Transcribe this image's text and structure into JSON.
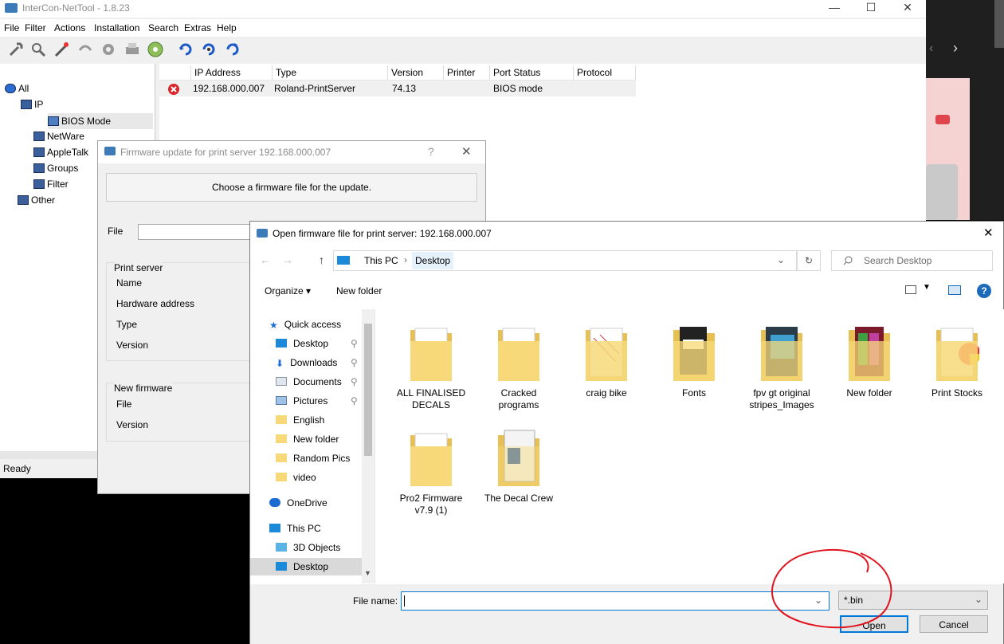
{
  "app": {
    "title": "InterCon-NetTool - 1.8.23",
    "menu": [
      "File",
      "Filter",
      "Actions",
      "Installation",
      "Search",
      "Extras",
      "Help"
    ],
    "tree": {
      "all": "All",
      "ip": "IP",
      "bios": "BIOS Mode",
      "netware": "NetWare",
      "appletalk": "AppleTalk",
      "groups": "Groups",
      "filter": "Filter",
      "other": "Other"
    },
    "columns": [
      "IP Address",
      "Type",
      "Version",
      "Printer",
      "Port Status",
      "Protocol"
    ],
    "rows": [
      {
        "ip": "192.168.000.007",
        "type": "Roland-PrintServer",
        "version": "74.13",
        "printer": "",
        "port_status": "BIOS mode",
        "protocol": ""
      }
    ],
    "status": "Ready",
    "window_buttons": {
      "min": "—",
      "max": "☐",
      "close": "✕"
    }
  },
  "fw_dialog": {
    "title": "Firmware update for print server 192.168.000.007",
    "help": "?",
    "close": "✕",
    "header": "Choose a firmware file for the update.",
    "file_label": "File",
    "print_server_group": "Print server",
    "name_label": "Name",
    "hw_label": "Hardware address",
    "type_label": "Type",
    "version_label": "Version",
    "new_fw_group": "New firmware",
    "new_file_label": "File",
    "new_version_label": "Version"
  },
  "open_dialog": {
    "title": "Open firmware file for print server: 192.168.000.007",
    "close": "✕",
    "breadcrumb": [
      "This PC",
      "Desktop"
    ],
    "search_placeholder": "Search Desktop",
    "organize": "Organize ▾",
    "new_folder": "New folder",
    "help": "?",
    "nav": {
      "quick_access": "Quick access",
      "pinned": [
        "Desktop",
        "Downloads",
        "Documents",
        "Pictures"
      ],
      "folders": [
        "English",
        "New folder",
        "Random Pics",
        "video"
      ],
      "onedrive": "OneDrive",
      "this_pc": "This PC",
      "objects3d": "3D Objects",
      "desktop": "Desktop"
    },
    "files": [
      "ALL FINALISED DECALS",
      "Cracked programs",
      "craig bike",
      "Fonts",
      "fpv gt original stripes_Images",
      "New folder",
      "Print Stocks",
      "Pro2 Firmware v7.9 (1)",
      "The Decal Crew"
    ],
    "file_name_label": "File name:",
    "file_name_value": "",
    "filter": "*.bin",
    "open": "Open",
    "cancel": "Cancel"
  },
  "colors": {
    "accent": "#0078d7",
    "folder": "#f7d97a",
    "annotation": "#e0141e",
    "selection": "#cce8ff"
  }
}
